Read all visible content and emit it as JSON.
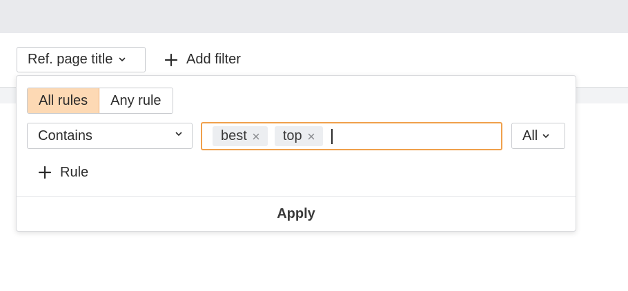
{
  "filter_bar": {
    "field_button_label": "Ref. page title",
    "add_filter_label": "Add filter"
  },
  "popover": {
    "match_mode": {
      "options": [
        "All rules",
        "Any rule"
      ],
      "selected": "All rules"
    },
    "rule": {
      "condition": "Contains",
      "tags": [
        "best",
        "top"
      ],
      "quantifier": "All"
    },
    "add_rule_label": "Rule",
    "apply_label": "Apply"
  },
  "colors": {
    "active_segment_bg": "#fdd9b4",
    "input_focus_border": "#f0a04b",
    "tag_bg": "#eceef1"
  },
  "icons": [
    "chevron-down-icon",
    "plus-icon",
    "close-icon"
  ]
}
